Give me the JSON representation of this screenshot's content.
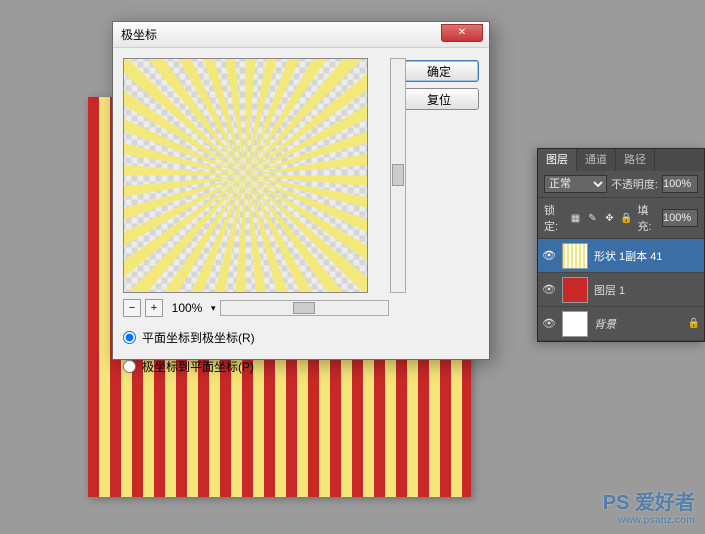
{
  "dialog": {
    "title": "极坐标",
    "buttons": {
      "ok": "确定",
      "reset": "复位"
    },
    "zoom": {
      "value": "100%",
      "minus": "−",
      "plus": "+"
    },
    "options": {
      "rect_to_polar": "平面坐标到极坐标(R)",
      "polar_to_rect": "极坐标到平面坐标(P)"
    },
    "close_glyph": "✕"
  },
  "layers_panel": {
    "tabs": {
      "layers": "图层",
      "channels": "通道",
      "paths": "路径"
    },
    "blend_mode": "正常",
    "opacity_label": "不透明度:",
    "opacity_value": "100%",
    "lock_label": "锁定:",
    "fill_label": "填充:",
    "fill_value": "100%",
    "lock_icons": {
      "trans": "▦",
      "brush": "✎",
      "move": "✥",
      "all": "🔒"
    },
    "eye_glyph": "👁",
    "lock_glyph": "🔒",
    "items": [
      {
        "name": "形状 1副本 41",
        "selected": true,
        "thumb": "pattern"
      },
      {
        "name": "图层 1",
        "selected": false,
        "thumb": "red"
      },
      {
        "name": "背景",
        "selected": false,
        "thumb": "white",
        "locked": true
      }
    ]
  },
  "watermark": {
    "main": "PS 爱好者",
    "sub": "www.psahz.com"
  }
}
